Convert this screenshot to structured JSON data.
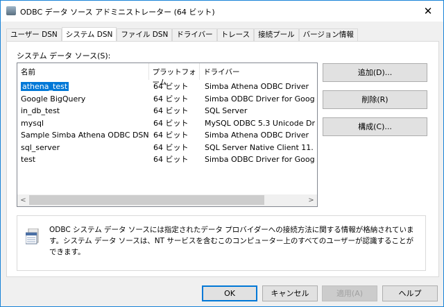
{
  "window": {
    "title": "ODBC データ ソース アドミニストレーター (64 ビット)",
    "close": "✕"
  },
  "tabs": [
    {
      "label": "ユーザー DSN"
    },
    {
      "label": "システム DSN",
      "active": true
    },
    {
      "label": "ファイル DSN"
    },
    {
      "label": "ドライバー"
    },
    {
      "label": "トレース"
    },
    {
      "label": "接続プール"
    },
    {
      "label": "バージョン情報"
    }
  ],
  "panel": {
    "label": "システム データ ソース(S):",
    "columns": [
      "名前",
      "プラットフォーム",
      "ドライバー"
    ],
    "rows": [
      [
        "athena_test",
        "64 ビット",
        "Simba Athena ODBC Driver"
      ],
      [
        "Google BigQuery",
        "64 ビット",
        "Simba ODBC Driver for Goog"
      ],
      [
        "in_db_test",
        "64 ビット",
        "SQL Server"
      ],
      [
        "mysql",
        "64 ビット",
        "MySQL ODBC 5.3 Unicode Dr"
      ],
      [
        "Sample Simba Athena ODBC DSN",
        "64 ビット",
        "Simba Athena ODBC Driver"
      ],
      [
        "sql_server",
        "64 ビット",
        "SQL Server Native Client 11."
      ],
      [
        "test",
        "64 ビット",
        "Simba ODBC Driver for Goog"
      ]
    ],
    "selected_row": 0,
    "buttons": {
      "add": "追加(D)...",
      "remove": "削除(R)",
      "configure": "構成(C)..."
    },
    "info": "ODBC システム データ ソースには指定されたデータ プロバイダーへの接続方法に関する情報が格納されています。システム データ ソースは、NT サービスを含むこのコンピューター上のすべてのユーザーが認識することができます。"
  },
  "footer": {
    "ok": "OK",
    "cancel": "キャンセル",
    "apply": "適用(A)",
    "help": "ヘルプ"
  },
  "colors": {
    "selection": "#0078d7",
    "border": "#1883d7"
  }
}
